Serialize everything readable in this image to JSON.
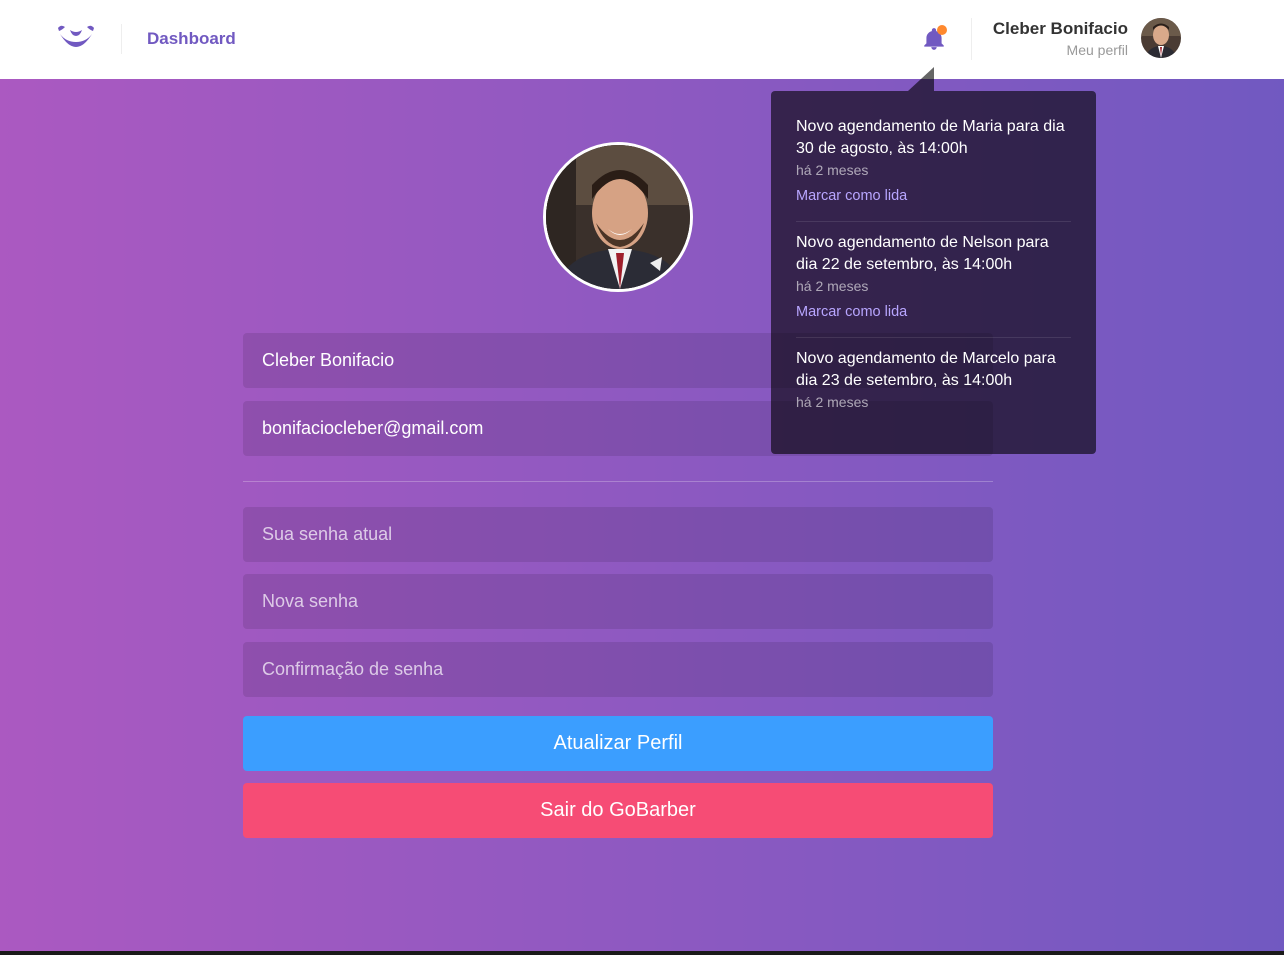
{
  "header": {
    "nav_dashboard": "Dashboard",
    "profile_name": "Cleber Bonifacio",
    "profile_link": "Meu perfil",
    "logo_icon": "mustache-logo-icon",
    "bell_icon": "bell-icon",
    "unread_indicator": true
  },
  "form": {
    "name_value": "Cleber Bonifacio",
    "email_value": "bonifaciocleber@gmail.com",
    "old_password_placeholder": "Sua senha atual",
    "new_password_placeholder": "Nova senha",
    "confirm_password_placeholder": "Confirmação de senha",
    "update_button": "Atualizar Perfil",
    "logout_button": "Sair do GoBarber"
  },
  "notifications": [
    {
      "text": "Novo agendamento de Maria para dia 30 de agosto, às 14:00h",
      "time": "há 2 meses",
      "action": "Marcar como lida"
    },
    {
      "text": "Novo agendamento de Nelson para dia 22 de setembro, às 14:00h",
      "time": "há 2 meses",
      "action": "Marcar como lida"
    },
    {
      "text": "Novo agendamento de Marcelo para dia 23 de setembro, às 14:00h",
      "time": "há 2 meses",
      "action": ""
    }
  ],
  "colors": {
    "brand": "#7159c1",
    "gradient_start": "#ab59c1",
    "update_button": "#3b9eff",
    "logout_button": "#f64c75",
    "notification_dot": "#ff892e"
  }
}
